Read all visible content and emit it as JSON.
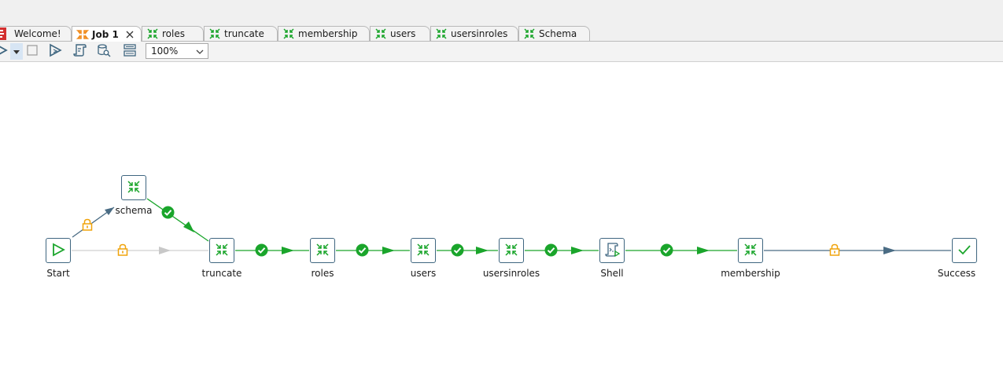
{
  "tabs": [
    {
      "label": "Welcome!",
      "icon": "talend-logo-icon",
      "active": false
    },
    {
      "label": "Job 1",
      "icon": "job-icon",
      "active": true,
      "closable": true
    },
    {
      "label": "roles",
      "icon": "joblet-icon",
      "active": false
    },
    {
      "label": "truncate",
      "icon": "joblet-icon",
      "active": false
    },
    {
      "label": "membership",
      "icon": "joblet-icon",
      "active": false
    },
    {
      "label": "users",
      "icon": "joblet-icon",
      "active": false
    },
    {
      "label": "usersinroles",
      "icon": "joblet-icon",
      "active": false
    },
    {
      "label": "Schema",
      "icon": "joblet-icon",
      "active": false
    }
  ],
  "toolbar": {
    "buttons": [
      "run-icon",
      "dropdown-icon",
      "stop-icon",
      "debug-run-icon",
      "script-icon",
      "database-search-icon",
      "layout-icon"
    ],
    "zoom_value": "100%"
  },
  "nodes": {
    "start": {
      "label": "Start",
      "icon": "start-icon"
    },
    "schema": {
      "label": "schema",
      "icon": "joblet-icon"
    },
    "truncate": {
      "label": "truncate",
      "icon": "joblet-icon"
    },
    "roles": {
      "label": "roles",
      "icon": "joblet-icon"
    },
    "users": {
      "label": "users",
      "icon": "joblet-icon"
    },
    "usersinroles": {
      "label": "usersinroles",
      "icon": "joblet-icon"
    },
    "shell": {
      "label": "Shell",
      "icon": "shell-script-icon"
    },
    "membership": {
      "label": "membership",
      "icon": "joblet-icon"
    },
    "success": {
      "label": "Success",
      "icon": "checkmark-icon"
    }
  },
  "links": [
    {
      "from": "start",
      "to": "schema",
      "type": "trigger",
      "marker": "lock-icon",
      "color": "#4a6c84"
    },
    {
      "from": "start",
      "to": "truncate",
      "type": "inactive",
      "marker": "lock-icon",
      "color": "#c8c8c8"
    },
    {
      "from": "schema",
      "to": "truncate",
      "type": "on-ok",
      "marker": "check-icon",
      "color": "#1aa52b"
    },
    {
      "from": "truncate",
      "to": "roles",
      "type": "on-ok",
      "marker": "check-icon",
      "color": "#1aa52b"
    },
    {
      "from": "roles",
      "to": "users",
      "type": "on-ok",
      "marker": "check-icon",
      "color": "#1aa52b"
    },
    {
      "from": "users",
      "to": "usersinroles",
      "type": "on-ok",
      "marker": "check-icon",
      "color": "#1aa52b"
    },
    {
      "from": "usersinroles",
      "to": "shell",
      "type": "on-ok",
      "marker": "check-icon",
      "color": "#1aa52b"
    },
    {
      "from": "shell",
      "to": "membership",
      "type": "on-ok",
      "marker": "check-icon",
      "color": "#1aa52b"
    },
    {
      "from": "membership",
      "to": "success",
      "type": "trigger",
      "marker": "lock-icon",
      "color": "#4a6c84"
    }
  ],
  "colors": {
    "node_border": "#3f6680",
    "ok_green": "#1aa52b",
    "trigger_blue": "#4a6c84",
    "lock_orange": "#f0a30a",
    "inactive_gray": "#c8c8c8",
    "job_orange": "#f08c1e",
    "brand_red": "#d32f2f"
  }
}
